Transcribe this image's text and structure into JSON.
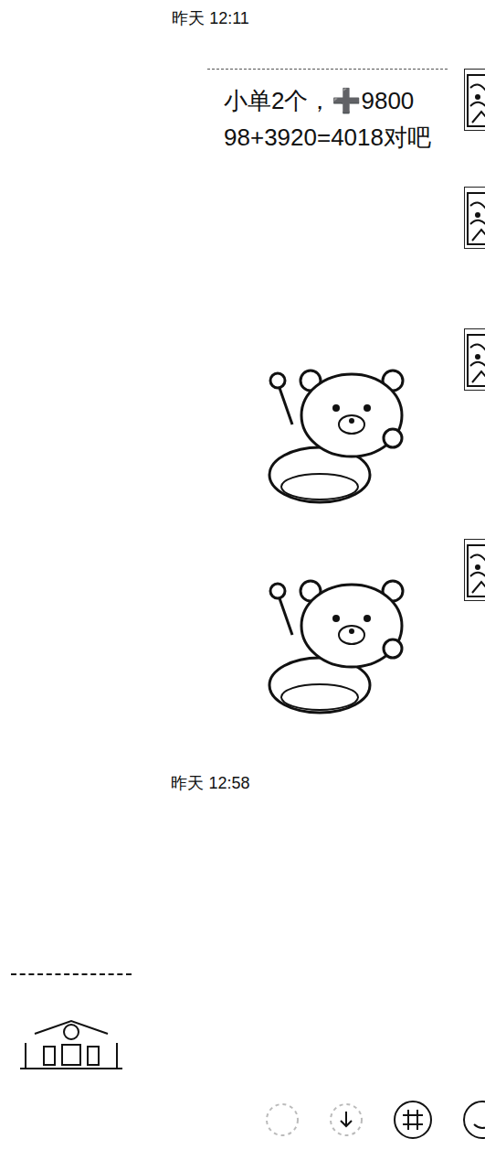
{
  "messages": [
    {
      "kind": "time",
      "text": "昨天 12:11"
    },
    {
      "kind": "text",
      "side": "right",
      "lines": [
        "小单2个，➕9800",
        "98+3920=4018对吧"
      ]
    },
    {
      "kind": "blank",
      "side": "right"
    },
    {
      "kind": "sticker",
      "side": "right"
    },
    {
      "kind": "sticker",
      "side": "right"
    },
    {
      "kind": "time",
      "text": "昨天 12:58"
    },
    {
      "kind": "image",
      "side": "left"
    }
  ]
}
